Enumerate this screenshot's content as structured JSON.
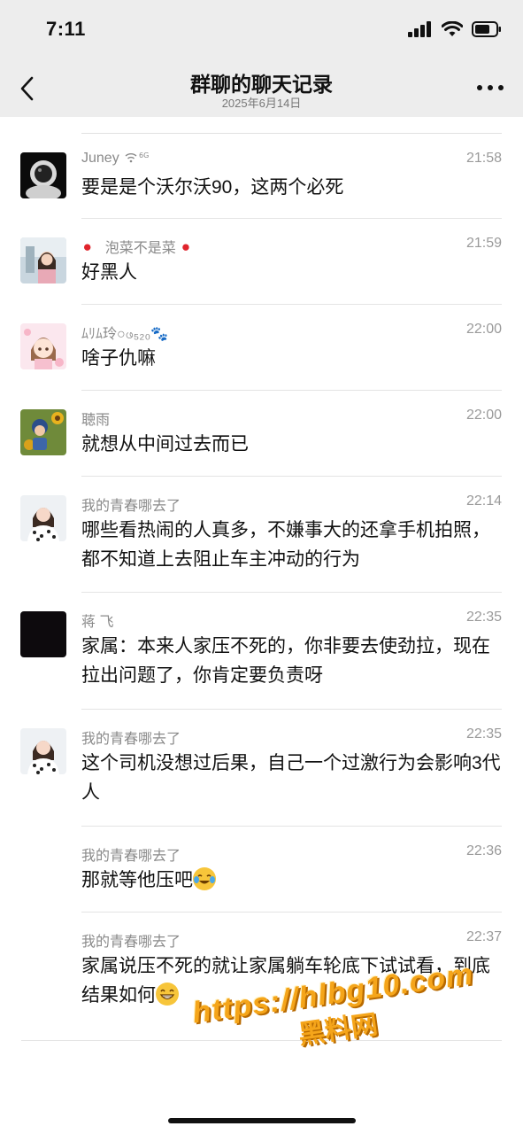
{
  "status_bar": {
    "time": "7:11"
  },
  "nav": {
    "title": "群聊的聊天记录",
    "date": "2025年6月14日"
  },
  "messages": [
    {
      "sender": "Juney",
      "sender_suffix": "ᴪᴳ",
      "time": "21:58",
      "text": "要是是个沃尔沃90，这两个必死",
      "avatar": "astronaut"
    },
    {
      "sender": "泡菜不是菜",
      "time": "21:59",
      "text": "好黑人",
      "avatar": "girl-photo"
    },
    {
      "sender": "ﾑﾘﾑ玲○ဖ₅₂₀🐾",
      "time": "22:00",
      "text": "啥子仇嘛",
      "avatar": "cartoon-girl"
    },
    {
      "sender": "聴雨",
      "time": "22:00",
      "text": "就想从中间过去而已",
      "avatar": "boy-sunflower"
    },
    {
      "sender": "我的青春哪去了",
      "time": "22:14",
      "text": "哪些看热闹的人真多，不嫌事大的还拿手机拍照，都不知道上去阻止车主冲动的行为",
      "avatar": "girl-polka"
    },
    {
      "sender": "蒋 飞",
      "time": "22:35",
      "text": "家属：本来人家压不死的，你非要去使劲拉，现在拉出问题了，你肯定要负责呀",
      "avatar": "black"
    },
    {
      "sender": "我的青春哪去了",
      "time": "22:35",
      "text": "这个司机没想过后果，自己一个过激行为会影响3代人",
      "avatar": "girl-polka"
    },
    {
      "sender": "我的青春哪去了",
      "time": "22:36",
      "text": "那就等他压吧",
      "avatar": ""
    },
    {
      "sender": "我的青春哪去了",
      "time": "22:37",
      "text": "家属说压不死的就让家属躺车轮底下试试看，到底结果如何",
      "avatar": ""
    }
  ],
  "watermark": {
    "url": "https://hlbg10.com",
    "text": "黑料网"
  }
}
